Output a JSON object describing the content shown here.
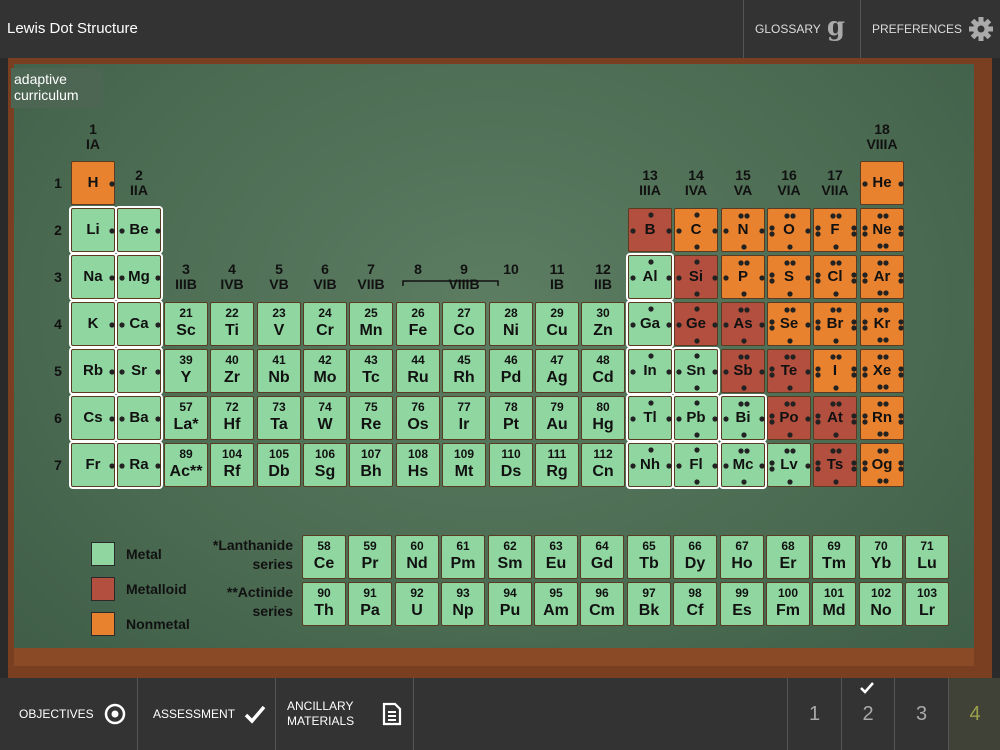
{
  "header": {
    "title": "Lewis Dot Structure",
    "glossary_label": "GLOSSARY",
    "glossary_icon": "g",
    "preferences_label": "PREFERENCES"
  },
  "logo": {
    "line1": "adaptive",
    "line2": "curriculum"
  },
  "groups": [
    {
      "num": "1",
      "roman": "IA"
    },
    {
      "num": "2",
      "roman": "IIA"
    },
    {
      "num": "3",
      "roman": "IIIB"
    },
    {
      "num": "4",
      "roman": "IVB"
    },
    {
      "num": "5",
      "roman": "VB"
    },
    {
      "num": "6",
      "roman": "VIB"
    },
    {
      "num": "7",
      "roman": "VIIB"
    },
    {
      "num": "8",
      "roman": ""
    },
    {
      "num": "9",
      "roman": "VIIIB"
    },
    {
      "num": "10",
      "roman": ""
    },
    {
      "num": "11",
      "roman": "IB"
    },
    {
      "num": "12",
      "roman": "IIB"
    },
    {
      "num": "13",
      "roman": "IIIA"
    },
    {
      "num": "14",
      "roman": "IVA"
    },
    {
      "num": "15",
      "roman": "VA"
    },
    {
      "num": "16",
      "roman": "VIA"
    },
    {
      "num": "17",
      "roman": "VIIA"
    },
    {
      "num": "18",
      "roman": "VIIIA"
    }
  ],
  "periods": [
    "1",
    "2",
    "3",
    "4",
    "5",
    "6",
    "7"
  ],
  "elements": [
    [
      "H",
      1,
      1,
      "nonmetal",
      null,
      1
    ],
    [
      "He",
      1,
      18,
      "nonmetal",
      null,
      2
    ],
    [
      "Li",
      2,
      1,
      "metal",
      null,
      1
    ],
    [
      "Be",
      2,
      2,
      "metal",
      null,
      2
    ],
    [
      "B",
      2,
      13,
      "metalloid",
      null,
      3
    ],
    [
      "C",
      2,
      14,
      "nonmetal",
      null,
      4
    ],
    [
      "N",
      2,
      15,
      "nonmetal",
      null,
      5
    ],
    [
      "O",
      2,
      16,
      "nonmetal",
      null,
      6
    ],
    [
      "F",
      2,
      17,
      "nonmetal",
      null,
      7
    ],
    [
      "Ne",
      2,
      18,
      "nonmetal",
      null,
      8
    ],
    [
      "Na",
      3,
      1,
      "metal",
      null,
      1
    ],
    [
      "Mg",
      3,
      2,
      "metal",
      null,
      2
    ],
    [
      "Al",
      3,
      13,
      "metal",
      null,
      3
    ],
    [
      "Si",
      3,
      14,
      "metalloid",
      null,
      4
    ],
    [
      "P",
      3,
      15,
      "nonmetal",
      null,
      5
    ],
    [
      "S",
      3,
      16,
      "nonmetal",
      null,
      6
    ],
    [
      "Cl",
      3,
      17,
      "nonmetal",
      null,
      7
    ],
    [
      "Ar",
      3,
      18,
      "nonmetal",
      null,
      8
    ],
    [
      "K",
      4,
      1,
      "metal",
      null,
      1
    ],
    [
      "Ca",
      4,
      2,
      "metal",
      null,
      2
    ],
    [
      "Sc",
      4,
      3,
      "metal",
      "21",
      0
    ],
    [
      "Ti",
      4,
      4,
      "metal",
      "22",
      0
    ],
    [
      "V",
      4,
      5,
      "metal",
      "23",
      0
    ],
    [
      "Cr",
      4,
      6,
      "metal",
      "24",
      0
    ],
    [
      "Mn",
      4,
      7,
      "metal",
      "25",
      0
    ],
    [
      "Fe",
      4,
      8,
      "metal",
      "26",
      0
    ],
    [
      "Co",
      4,
      9,
      "metal",
      "27",
      0
    ],
    [
      "Ni",
      4,
      10,
      "metal",
      "28",
      0
    ],
    [
      "Cu",
      4,
      11,
      "metal",
      "29",
      0
    ],
    [
      "Zn",
      4,
      12,
      "metal",
      "30",
      0
    ],
    [
      "Ga",
      4,
      13,
      "metal",
      null,
      3
    ],
    [
      "Ge",
      4,
      14,
      "metalloid",
      null,
      4
    ],
    [
      "As",
      4,
      15,
      "metalloid",
      null,
      5
    ],
    [
      "Se",
      4,
      16,
      "nonmetal",
      null,
      6
    ],
    [
      "Br",
      4,
      17,
      "nonmetal",
      null,
      7
    ],
    [
      "Kr",
      4,
      18,
      "nonmetal",
      null,
      8
    ],
    [
      "Rb",
      5,
      1,
      "metal",
      null,
      1
    ],
    [
      "Sr",
      5,
      2,
      "metal",
      null,
      2
    ],
    [
      "Y",
      5,
      3,
      "metal",
      "39",
      0
    ],
    [
      "Zr",
      5,
      4,
      "metal",
      "40",
      0
    ],
    [
      "Nb",
      5,
      5,
      "metal",
      "41",
      0
    ],
    [
      "Mo",
      5,
      6,
      "metal",
      "42",
      0
    ],
    [
      "Tc",
      5,
      7,
      "metal",
      "43",
      0
    ],
    [
      "Ru",
      5,
      8,
      "metal",
      "44",
      0
    ],
    [
      "Rh",
      5,
      9,
      "metal",
      "45",
      0
    ],
    [
      "Pd",
      5,
      10,
      "metal",
      "46",
      0
    ],
    [
      "Ag",
      5,
      11,
      "metal",
      "47",
      0
    ],
    [
      "Cd",
      5,
      12,
      "metal",
      "48",
      0
    ],
    [
      "In",
      5,
      13,
      "metal",
      null,
      3
    ],
    [
      "Sn",
      5,
      14,
      "metal",
      null,
      4
    ],
    [
      "Sb",
      5,
      15,
      "metalloid",
      null,
      5
    ],
    [
      "Te",
      5,
      16,
      "metalloid",
      null,
      6
    ],
    [
      "I",
      5,
      17,
      "nonmetal",
      null,
      7
    ],
    [
      "Xe",
      5,
      18,
      "nonmetal",
      null,
      8
    ],
    [
      "Cs",
      6,
      1,
      "metal",
      null,
      1
    ],
    [
      "Ba",
      6,
      2,
      "metal",
      null,
      2
    ],
    [
      "La*",
      6,
      3,
      "metal",
      "57",
      0
    ],
    [
      "Hf",
      6,
      4,
      "metal",
      "72",
      0
    ],
    [
      "Ta",
      6,
      5,
      "metal",
      "73",
      0
    ],
    [
      "W",
      6,
      6,
      "metal",
      "74",
      0
    ],
    [
      "Re",
      6,
      7,
      "metal",
      "75",
      0
    ],
    [
      "Os",
      6,
      8,
      "metal",
      "76",
      0
    ],
    [
      "Ir",
      6,
      9,
      "metal",
      "77",
      0
    ],
    [
      "Pt",
      6,
      10,
      "metal",
      "78",
      0
    ],
    [
      "Au",
      6,
      11,
      "metal",
      "79",
      0
    ],
    [
      "Hg",
      6,
      12,
      "metal",
      "80",
      0
    ],
    [
      "Tl",
      6,
      13,
      "metal",
      null,
      3
    ],
    [
      "Pb",
      6,
      14,
      "metal",
      null,
      4
    ],
    [
      "Bi",
      6,
      15,
      "metal",
      null,
      5
    ],
    [
      "Po",
      6,
      16,
      "metalloid",
      null,
      6
    ],
    [
      "At",
      6,
      17,
      "metalloid",
      null,
      7
    ],
    [
      "Rn",
      6,
      18,
      "nonmetal",
      null,
      8
    ],
    [
      "Fr",
      7,
      1,
      "metal",
      null,
      1
    ],
    [
      "Ra",
      7,
      2,
      "metal",
      null,
      2
    ],
    [
      "Ac**",
      7,
      3,
      "metal",
      "89",
      0
    ],
    [
      "Rf",
      7,
      4,
      "metal",
      "104",
      0
    ],
    [
      "Db",
      7,
      5,
      "metal",
      "105",
      0
    ],
    [
      "Sg",
      7,
      6,
      "metal",
      "106",
      0
    ],
    [
      "Bh",
      7,
      7,
      "metal",
      "107",
      0
    ],
    [
      "Hs",
      7,
      8,
      "metal",
      "108",
      0
    ],
    [
      "Mt",
      7,
      9,
      "metal",
      "109",
      0
    ],
    [
      "Ds",
      7,
      10,
      "metal",
      "110",
      0
    ],
    [
      "Rg",
      7,
      11,
      "metal",
      "111",
      0
    ],
    [
      "Cn",
      7,
      12,
      "metal",
      "112",
      0
    ],
    [
      "Nh",
      7,
      13,
      "metal",
      null,
      3
    ],
    [
      "Fl",
      7,
      14,
      "metal",
      null,
      4
    ],
    [
      "Mc",
      7,
      15,
      "metal",
      null,
      5
    ],
    [
      "Lv",
      7,
      16,
      "metal",
      null,
      6
    ],
    [
      "Ts",
      7,
      17,
      "metalloid",
      null,
      7
    ],
    [
      "Og",
      7,
      18,
      "nonmetal",
      null,
      8
    ]
  ],
  "lanthanides": {
    "label1": "*Lanthanide",
    "label2": "series",
    "items": [
      [
        "58",
        "Ce"
      ],
      [
        "59",
        "Pr"
      ],
      [
        "60",
        "Nd"
      ],
      [
        "61",
        "Pm"
      ],
      [
        "62",
        "Sm"
      ],
      [
        "63",
        "Eu"
      ],
      [
        "64",
        "Gd"
      ],
      [
        "65",
        "Tb"
      ],
      [
        "66",
        "Dy"
      ],
      [
        "67",
        "Ho"
      ],
      [
        "68",
        "Er"
      ],
      [
        "69",
        "Tm"
      ],
      [
        "70",
        "Yb"
      ],
      [
        "71",
        "Lu"
      ]
    ]
  },
  "actinides": {
    "label1": "**Actinide",
    "label2": "series",
    "items": [
      [
        "90",
        "Th"
      ],
      [
        "91",
        "Pa"
      ],
      [
        "92",
        "U"
      ],
      [
        "93",
        "Np"
      ],
      [
        "94",
        "Pu"
      ],
      [
        "95",
        "Am"
      ],
      [
        "96",
        "Cm"
      ],
      [
        "97",
        "Bk"
      ],
      [
        "98",
        "Cf"
      ],
      [
        "99",
        "Es"
      ],
      [
        "100",
        "Fm"
      ],
      [
        "101",
        "Md"
      ],
      [
        "102",
        "No"
      ],
      [
        "103",
        "Lr"
      ]
    ]
  },
  "legend": [
    {
      "label": "Metal",
      "color": "#8fd6a0"
    },
    {
      "label": "Metalloid",
      "color": "#b34f3f"
    },
    {
      "label": "Nonmetal",
      "color": "#e8822e"
    }
  ],
  "footer": {
    "objectives_label": "OBJECTIVES",
    "assessment_label": "ASSESSMENT",
    "ancillary_line1": "ANCILLARY",
    "ancillary_line2": "MATERIALS",
    "pages": [
      "1",
      "2",
      "3",
      "4"
    ],
    "active_page": "4",
    "completed_page": "2"
  }
}
